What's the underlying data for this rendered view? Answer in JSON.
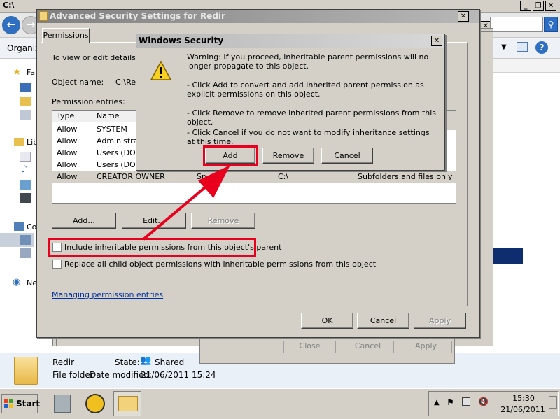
{
  "explorer": {
    "title": "C:\\",
    "toolbar_label": "Organize",
    "nav_labels": [
      "Fa",
      "Lib",
      "Co",
      "Ne"
    ],
    "details": {
      "name": "Redir",
      "state_label": "State:",
      "state_value": "Shared",
      "type_label": "File folder",
      "date_label": "Date modified:",
      "date_value": "21/06/2011 15:24"
    }
  },
  "advanced_dialog": {
    "title": "Advanced Security Settings for Redir",
    "tab_label": "Permissions",
    "intro_text": "To view or edit details for",
    "object_name_label": "Object name:",
    "object_name_value": "C:\\Re",
    "permission_entries_label": "Permission entries:",
    "columns": [
      "Type",
      "Name"
    ],
    "entries": [
      {
        "type": "Allow",
        "name": "SYSTEM",
        "inherited": "",
        "apply": ""
      },
      {
        "type": "Allow",
        "name": "Administrat",
        "inherited": "",
        "apply": ""
      },
      {
        "type": "Allow",
        "name": "Users (DOM",
        "inherited": "",
        "apply": ""
      },
      {
        "type": "Allow",
        "name": "Users (DOM",
        "inherited": "",
        "apply": ""
      },
      {
        "type": "Allow",
        "name": "CREATOR OWNER",
        "perm": "Sp",
        "inherited": "C:\\",
        "apply": "Subfolders and files only"
      }
    ],
    "add_button": "Add...",
    "edit_button": "Edit...",
    "remove_button": "Remove",
    "include_inheritable_label": "Include inheritable permissions from this object's parent",
    "replace_child_label": "Replace all child object permissions with inheritable permissions from this object",
    "managing_link": "Managing permission entries",
    "ok_button": "OK",
    "cancel_button": "Cancel",
    "apply_button": "Apply"
  },
  "behind_window": {
    "close_button": "Close",
    "cancel_button": "Cancel",
    "apply_button": "Apply"
  },
  "security_dialog": {
    "title": "Windows Security",
    "warning_text": "Warning: If you proceed, inheritable parent permissions will no longer propagate to this object.",
    "add_text": "- Click Add to convert and add inherited parent permission as explicit permissions on this object.",
    "remove_text": "- Click Remove to remove inherited parent permissions from this object.",
    "cancel_text": "- Click Cancel if you do not want to modify inheritance settings at this time.",
    "add_button": "Add",
    "remove_button": "Remove",
    "cancel_button": "Cancel"
  },
  "taskbar": {
    "start_label": "Start",
    "clock_time": "15:30",
    "clock_date": "21/06/2011"
  },
  "colors": {
    "annotation_red": "#e8001c",
    "title_inactive": "#808080",
    "dialog_face": "#d4d0c8"
  }
}
